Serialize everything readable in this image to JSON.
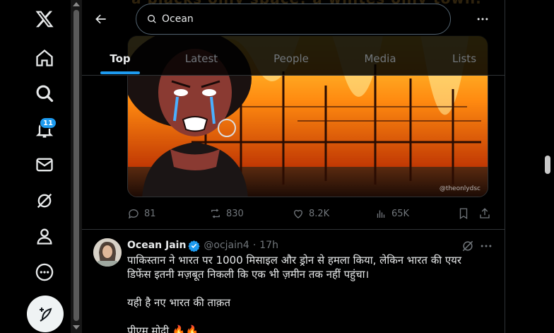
{
  "nav": {
    "notifications_badge": "11",
    "icons": [
      "x-logo-icon",
      "home-icon",
      "explore-icon",
      "notifications-icon",
      "messages-icon",
      "grok-icon",
      "profile-icon",
      "more-icon",
      "compose-icon"
    ]
  },
  "search": {
    "value": "Ocean",
    "placeholder": "Search"
  },
  "header_overlay_text": "a blacks only space!    a whites only town.",
  "tabs": [
    {
      "label": "Top",
      "active": true
    },
    {
      "label": "Latest",
      "active": false
    },
    {
      "label": "People",
      "active": false
    },
    {
      "label": "Media",
      "active": false
    },
    {
      "label": "Lists",
      "active": false
    }
  ],
  "tweet1": {
    "watermark": "@theonlydsc",
    "replies": "81",
    "retweets": "830",
    "likes": "8.2K",
    "views": "65K"
  },
  "tweet2": {
    "name": "Ocean Jain",
    "handle": "@ocjain4",
    "separator": "·",
    "time": "17h",
    "line1": "पाकिस्तान ने भारत पर 1000 मिसाइल और ड्रोन से हमला किया, लेकिन भारत की एयर",
    "line2": "डिफेंस इतनी मज़बूत निकली कि एक भी ज़मीन तक नहीं पहुंचा।",
    "line3": "यही है नए भारत की ताक़त",
    "line4": "पीएम मोदी 🔥🔥"
  },
  "colors": {
    "accent": "#1d9bf0",
    "text_primary": "#e7e9ea",
    "text_secondary": "#71767b",
    "border": "#2f3336",
    "background": "#000000"
  }
}
